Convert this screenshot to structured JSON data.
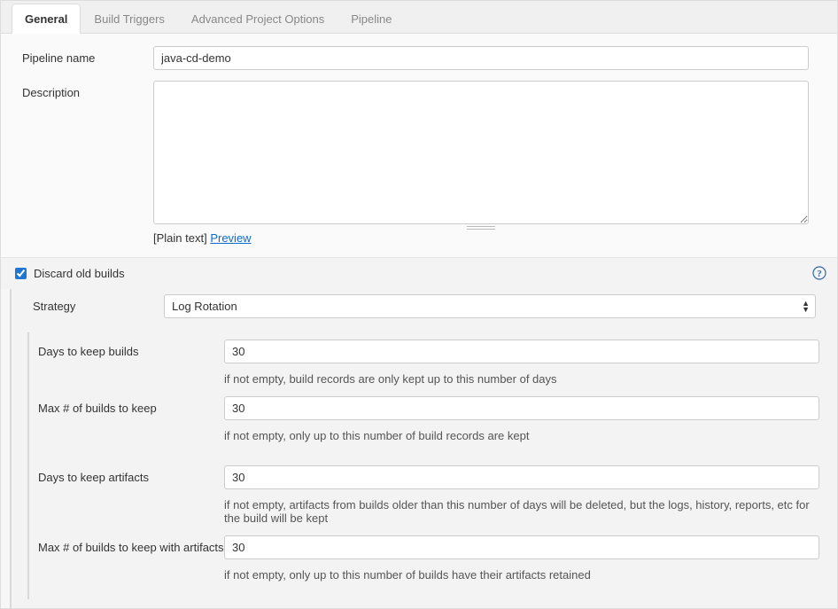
{
  "tabs": [
    {
      "label": "General"
    },
    {
      "label": "Build Triggers"
    },
    {
      "label": "Advanced Project Options"
    },
    {
      "label": "Pipeline"
    }
  ],
  "activeTabIndex": 0,
  "general": {
    "pipeline_name_label": "Pipeline name",
    "pipeline_name_value": "java-cd-demo",
    "description_label": "Description",
    "description_value": "",
    "plain_text_label": "[Plain text]",
    "preview_link": "Preview",
    "discard_old_builds_checked": true,
    "discard_old_builds_label": "Discard old builds",
    "strategy_label": "Strategy",
    "strategy_value": "Log Rotation",
    "strategy_options": [
      "Log Rotation"
    ],
    "fields": [
      {
        "label": "Days to keep builds",
        "value": "30",
        "help": "if not empty, build records are only kept up to this number of days"
      },
      {
        "label": "Max # of builds to keep",
        "value": "30",
        "help": "if not empty, only up to this number of build records are kept"
      },
      {
        "label": "Days to keep artifacts",
        "value": "30",
        "help": "if not empty, artifacts from builds older than this number of days will be deleted, but the logs, history, reports, etc for the build will be kept"
      },
      {
        "label": "Max # of builds to keep with artifacts",
        "value": "30",
        "help": "if not empty, only up to this number of builds have their artifacts retained"
      }
    ]
  }
}
